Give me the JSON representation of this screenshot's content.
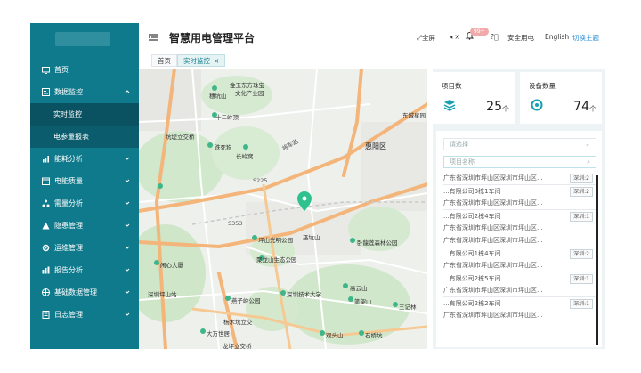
{
  "app": {
    "title": "智慧用电管理平台"
  },
  "header": {
    "fullscreen": "全屏",
    "badge": "99+",
    "safe_power": "安全用电",
    "language": "English",
    "theme": "切换主题"
  },
  "tabs": [
    {
      "label": "首页"
    },
    {
      "label": "实时监控",
      "active": true
    }
  ],
  "sidebar": {
    "items": [
      {
        "label": "首页",
        "icon": "monitor-icon"
      },
      {
        "label": "数据监控",
        "icon": "data-monitor-icon",
        "expanded": true,
        "children": [
          {
            "label": "实时监控",
            "active": true
          },
          {
            "label": "电参量报表"
          }
        ]
      },
      {
        "label": "能耗分析",
        "icon": "energy-icon"
      },
      {
        "label": "电能质量",
        "icon": "quality-icon"
      },
      {
        "label": "需量分析",
        "icon": "demand-icon"
      },
      {
        "label": "隐患管理",
        "icon": "warning-icon"
      },
      {
        "label": "运维管理",
        "icon": "ops-icon"
      },
      {
        "label": "报告分析",
        "icon": "report-icon"
      },
      {
        "label": "基础数据管理",
        "icon": "base-data-icon"
      },
      {
        "label": "日志管理",
        "icon": "log-icon"
      }
    ]
  },
  "stats": [
    {
      "label": "项目数",
      "value": "25",
      "unit": "个"
    },
    {
      "label": "设备数量",
      "value": "74",
      "unit": "个"
    }
  ],
  "filter": {
    "select_placeholder": "请选择",
    "search_placeholder": "项目名称"
  },
  "list": [
    {
      "text": "广东省深圳市坪山区深圳市坪山区...",
      "tag": "深圳:2",
      "sep": false
    },
    {
      "text": "...有限公司3栋1车间",
      "tag": "深圳:2",
      "sep": true
    },
    {
      "text": "广东省深圳市坪山区深圳市坪山区...",
      "tag": "",
      "sep": false
    },
    {
      "text": "...有限公司2栋4车间",
      "tag": "深圳:1",
      "sep": true
    },
    {
      "text": "广东省深圳市坪山区深圳市坪山区...",
      "tag": "",
      "sep": false
    },
    {
      "text": "广东省深圳市坪山区深圳市坪山区...",
      "tag": "",
      "sep": false
    },
    {
      "text": "...有限公司1栋4车间",
      "tag": "深圳:2",
      "sep": true
    },
    {
      "text": "广东省深圳市坪山区深圳市坪山区...",
      "tag": "",
      "sep": false
    },
    {
      "text": "...有限公司2栋5车间",
      "tag": "深圳:1",
      "sep": true
    },
    {
      "text": "广东省深圳市坪山区深圳市坪山区...",
      "tag": "",
      "sep": false
    },
    {
      "text": "...有限公司2栋2车间",
      "tag": "深圳:1",
      "sep": true
    },
    {
      "text": "广东省深圳市坪山区深圳市坪山区...",
      "tag": "",
      "sep": false
    }
  ],
  "map": {
    "labels": [
      {
        "text": "金玉东方珠宝",
        "id": "l1"
      },
      {
        "text": "文化产业园",
        "id": "l2"
      },
      {
        "text": "穗坑山",
        "id": "l3"
      },
      {
        "text": "十二岭顶",
        "id": "l4"
      },
      {
        "text": "坑堤立交桥",
        "id": "l5"
      },
      {
        "text": "跌死狗",
        "id": "l6"
      },
      {
        "text": "长岭窝",
        "id": "l7"
      },
      {
        "text": "将军路",
        "id": "l8"
      },
      {
        "text": "惠阳区",
        "id": "l9"
      },
      {
        "text": "东城星园",
        "id": "l10"
      },
      {
        "text": "坪山光明公园",
        "id": "l11"
      },
      {
        "text": "聚龙山生态公园",
        "id": "l12"
      },
      {
        "text": "巫坑山",
        "id": "l13"
      },
      {
        "text": "卧龍莲森林公园",
        "id": "l14"
      },
      {
        "text": "闲心大厦",
        "id": "l15"
      },
      {
        "text": "深圳技术大学",
        "id": "l16"
      },
      {
        "text": "高云山",
        "id": "l17"
      },
      {
        "text": "燕子岭公园",
        "id": "l18"
      },
      {
        "text": "笔架山",
        "id": "l19"
      },
      {
        "text": "三记林",
        "id": "l20"
      },
      {
        "text": "杨木坑立交",
        "id": "l21"
      },
      {
        "text": "大万世居",
        "id": "l22"
      },
      {
        "text": "观头山",
        "id": "l23"
      },
      {
        "text": "石桥坑",
        "id": "l24"
      },
      {
        "text": "龙坪立交桥",
        "id": "l25"
      },
      {
        "text": "深圳坪山站",
        "id": "l26"
      },
      {
        "text": "S225",
        "id": "l27"
      },
      {
        "text": "S353",
        "id": "l28"
      }
    ]
  }
}
